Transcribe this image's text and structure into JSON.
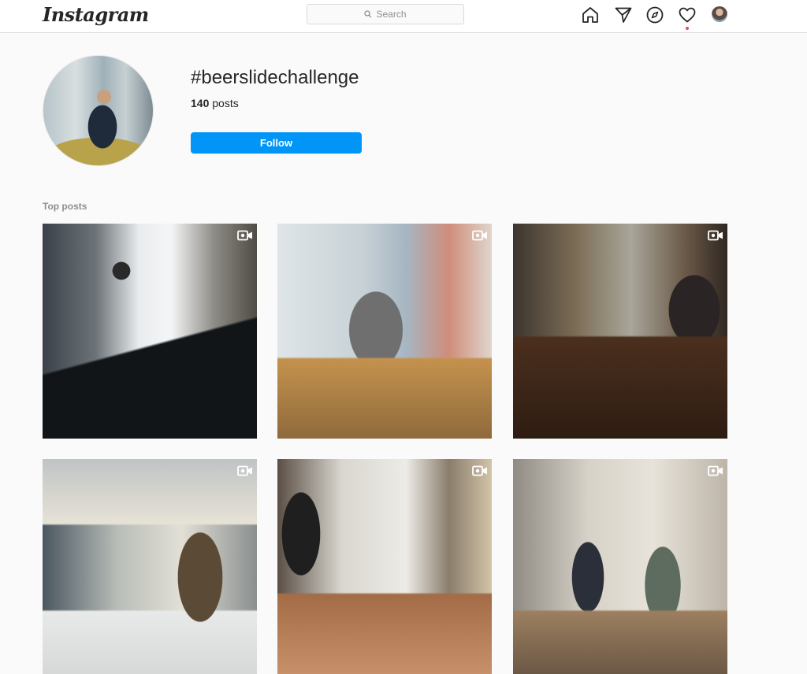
{
  "header": {
    "logo": "Instagram",
    "search_placeholder": "Search",
    "nav_icons": [
      "home-icon",
      "direct-icon",
      "explore-icon",
      "activity-heart-icon",
      "profile-avatar"
    ],
    "notification_dot_color": "#ed4956"
  },
  "tag": {
    "name": "#beerslidechallenge",
    "post_count": "140",
    "post_word": "posts",
    "follow_label": "Follow"
  },
  "section": {
    "top_posts_label": "Top posts"
  },
  "posts": [
    {
      "media": "video"
    },
    {
      "media": "video"
    },
    {
      "media": "video"
    },
    {
      "media": "video"
    },
    {
      "media": "video"
    },
    {
      "media": "video"
    }
  ],
  "colors": {
    "accent": "#0095f6",
    "text": "#262626",
    "muted": "#8e8e8e",
    "background": "#fafafa"
  }
}
